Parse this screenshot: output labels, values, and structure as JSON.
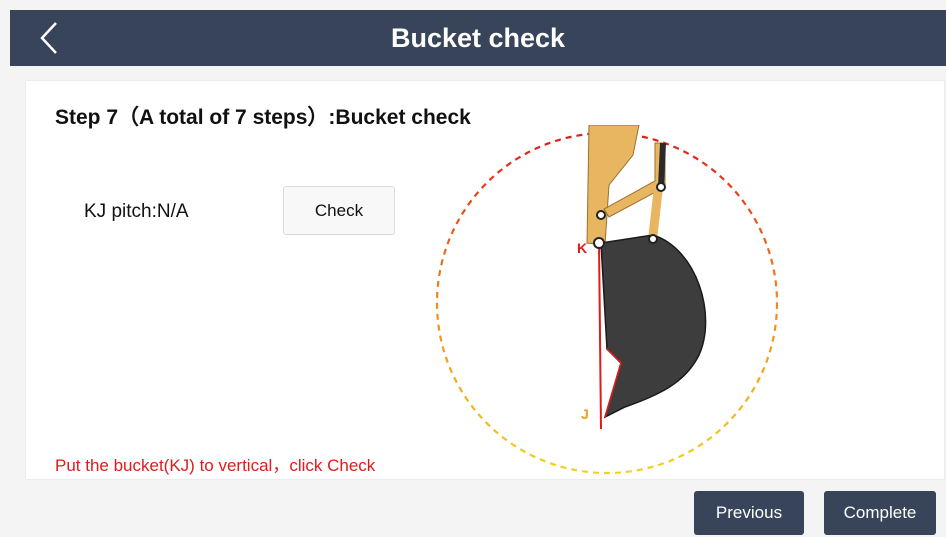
{
  "header": {
    "title": "Bucket check",
    "back_icon": "chevron-left-icon"
  },
  "step": {
    "title": "Step 7（A total of 7 steps）:Bucket check"
  },
  "pitch": {
    "label": "KJ pitch:N/A"
  },
  "actions": {
    "check_label": "Check",
    "previous_label": "Previous",
    "complete_label": "Complete"
  },
  "instruction": "Put the bucket(KJ) to vertical，click Check",
  "diagram": {
    "point_k": "K",
    "point_j": "J"
  },
  "colors": {
    "header": "#374459",
    "accent_red": "#e11a1a",
    "arm": "#e8b560",
    "bucket": "#3d3d3d"
  }
}
